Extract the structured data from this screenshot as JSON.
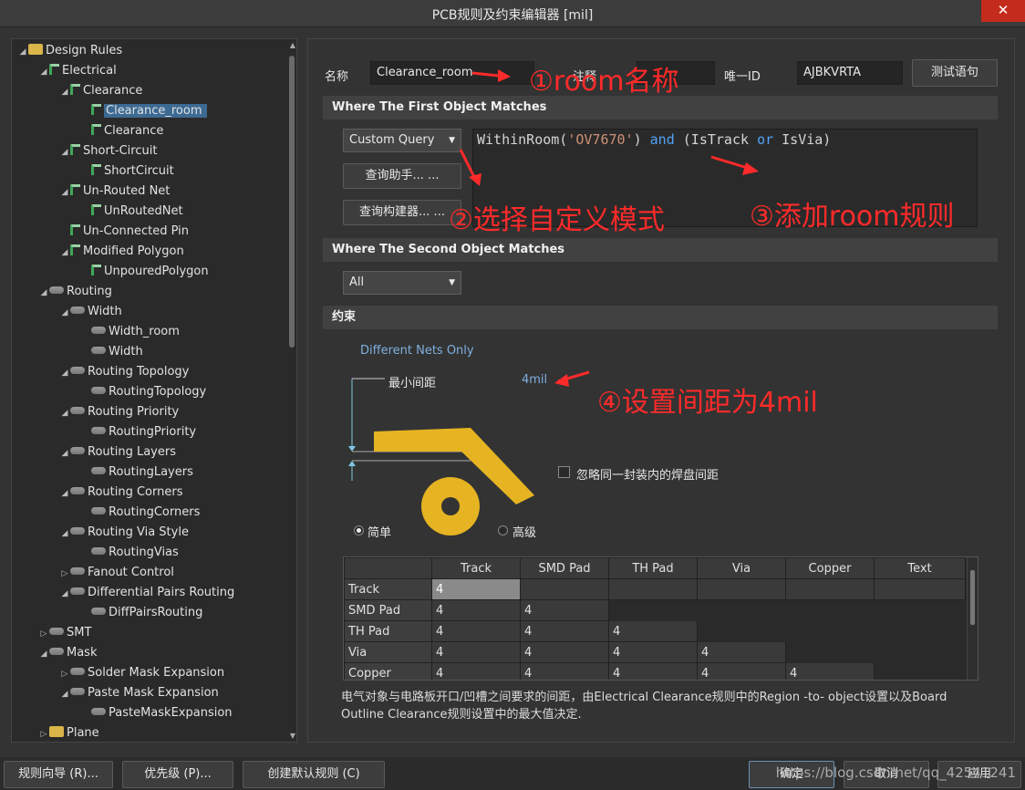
{
  "window": {
    "title": "PCB规则及约束编辑器 [mil]",
    "close": "✕"
  },
  "tree": [
    {
      "label": "Design Rules",
      "icon": "folder-icon",
      "twisty": "◢",
      "depth": 0
    },
    {
      "label": "Electrical",
      "icon": "rule-category-icon",
      "twisty": "◢",
      "depth": 1
    },
    {
      "label": "Clearance",
      "icon": "rule-icon",
      "twisty": "◢",
      "depth": 2
    },
    {
      "label": "Clearance_room",
      "icon": "rule-icon",
      "twisty": "",
      "depth": 3,
      "selected": true
    },
    {
      "label": "Clearance",
      "icon": "rule-icon",
      "twisty": "",
      "depth": 3
    },
    {
      "label": "Short-Circuit",
      "icon": "rule-icon",
      "twisty": "◢",
      "depth": 2
    },
    {
      "label": "ShortCircuit",
      "icon": "rule-icon",
      "twisty": "",
      "depth": 3
    },
    {
      "label": "Un-Routed Net",
      "icon": "rule-icon",
      "twisty": "◢",
      "depth": 2
    },
    {
      "label": "UnRoutedNet",
      "icon": "rule-icon",
      "twisty": "",
      "depth": 3
    },
    {
      "label": "Un-Connected Pin",
      "icon": "rule-icon",
      "twisty": "",
      "depth": 2
    },
    {
      "label": "Modified Polygon",
      "icon": "rule-icon",
      "twisty": "◢",
      "depth": 2
    },
    {
      "label": "UnpouredPolygon",
      "icon": "rule-icon",
      "twisty": "",
      "depth": 3
    },
    {
      "label": "Routing",
      "icon": "routing-icon",
      "twisty": "◢",
      "depth": 1
    },
    {
      "label": "Width",
      "icon": "routing-icon",
      "twisty": "◢",
      "depth": 2
    },
    {
      "label": "Width_room",
      "icon": "routing-icon",
      "twisty": "",
      "depth": 3
    },
    {
      "label": "Width",
      "icon": "routing-icon",
      "twisty": "",
      "depth": 3
    },
    {
      "label": "Routing Topology",
      "icon": "routing-icon",
      "twisty": "◢",
      "depth": 2
    },
    {
      "label": "RoutingTopology",
      "icon": "routing-icon",
      "twisty": "",
      "depth": 3
    },
    {
      "label": "Routing Priority",
      "icon": "routing-icon",
      "twisty": "◢",
      "depth": 2
    },
    {
      "label": "RoutingPriority",
      "icon": "routing-icon",
      "twisty": "",
      "depth": 3
    },
    {
      "label": "Routing Layers",
      "icon": "routing-icon",
      "twisty": "◢",
      "depth": 2
    },
    {
      "label": "RoutingLayers",
      "icon": "routing-icon",
      "twisty": "",
      "depth": 3
    },
    {
      "label": "Routing Corners",
      "icon": "routing-icon",
      "twisty": "◢",
      "depth": 2
    },
    {
      "label": "RoutingCorners",
      "icon": "routing-icon",
      "twisty": "",
      "depth": 3
    },
    {
      "label": "Routing Via Style",
      "icon": "routing-icon",
      "twisty": "◢",
      "depth": 2
    },
    {
      "label": "RoutingVias",
      "icon": "routing-icon",
      "twisty": "",
      "depth": 3
    },
    {
      "label": "Fanout Control",
      "icon": "routing-icon",
      "twisty": "▷",
      "depth": 2
    },
    {
      "label": "Differential Pairs Routing",
      "icon": "routing-icon",
      "twisty": "◢",
      "depth": 2
    },
    {
      "label": "DiffPairsRouting",
      "icon": "routing-icon",
      "twisty": "",
      "depth": 3
    },
    {
      "label": "SMT",
      "icon": "smt-icon",
      "twisty": "▷",
      "depth": 1
    },
    {
      "label": "Mask",
      "icon": "mask-icon",
      "twisty": "◢",
      "depth": 1
    },
    {
      "label": "Solder Mask Expansion",
      "icon": "mask-icon",
      "twisty": "▷",
      "depth": 2
    },
    {
      "label": "Paste Mask Expansion",
      "icon": "mask-icon",
      "twisty": "◢",
      "depth": 2
    },
    {
      "label": "PasteMaskExpansion",
      "icon": "mask-icon",
      "twisty": "",
      "depth": 3
    },
    {
      "label": "Plane",
      "icon": "plane-icon",
      "twisty": "▷",
      "depth": 1
    }
  ],
  "form": {
    "name_label": "名称",
    "name_value": "Clearance_room",
    "comment_label": "注释",
    "comment_value": "",
    "uid_label": "唯一ID",
    "uid_value": "AJBKVRTA",
    "test_button": "测试语句"
  },
  "first": {
    "header": "Where The First Object Matches",
    "mode": "Custom Query",
    "helper_button": "查询助手... ...",
    "builder_button": "查询构建器... ...",
    "query_a": "WithinRoom(",
    "query_str": "'OV7670'",
    "query_b": ") ",
    "query_and": "and",
    "query_c": " (IsTrack ",
    "query_or": "or",
    "query_d": " IsVia)"
  },
  "second": {
    "header": "Where The Second Object Matches",
    "mode": "All"
  },
  "constraints": {
    "header": "约束",
    "net_scope": "Different Nets Only",
    "min_clearance_label": "最小间距",
    "min_clearance_value": "4mil",
    "ignore_pad_label": "忽略同一封装内的焊盘间距",
    "simple_label": "简单",
    "advanced_label": "高级",
    "mode_selected": "simple"
  },
  "grid": {
    "columns": [
      "",
      "Track",
      "SMD Pad",
      "TH Pad",
      "Via",
      "Copper",
      "Text"
    ],
    "rows": [
      {
        "name": "Track",
        "cells": [
          "4",
          "",
          "",
          "",
          "",
          ""
        ]
      },
      {
        "name": "SMD Pad",
        "cells": [
          "4",
          "4",
          "",
          "",
          "",
          ""
        ]
      },
      {
        "name": "TH Pad",
        "cells": [
          "4",
          "4",
          "4",
          "",
          "",
          ""
        ]
      },
      {
        "name": "Via",
        "cells": [
          "4",
          "4",
          "4",
          "4",
          "",
          ""
        ]
      },
      {
        "name": "Copper",
        "cells": [
          "4",
          "4",
          "4",
          "4",
          "4",
          ""
        ]
      }
    ]
  },
  "description": "电气对象与电路板开口/凹槽之间要求的间距，由Electrical Clearance规则中的Region -to- object设置以及Board Outline Clearance规则设置中的最大值决定.",
  "annotations": {
    "a1": "①room名称",
    "a2": "②选择自定义模式",
    "a3": "③添加room规则",
    "a4": "④设置间距为4mil"
  },
  "buttons": {
    "wizard": "规则向导 (R)...",
    "priority": "优先级 (P)...",
    "default_rules": "创建默认规则 (C)",
    "ok": "确定",
    "cancel": "取消",
    "apply": "应用"
  },
  "watermark": "https://blog.csdn.net/qq_42541241",
  "colors": {
    "copper": "#e6b422",
    "annotation": "#ff2a2a",
    "selection": "#3c6a93"
  }
}
